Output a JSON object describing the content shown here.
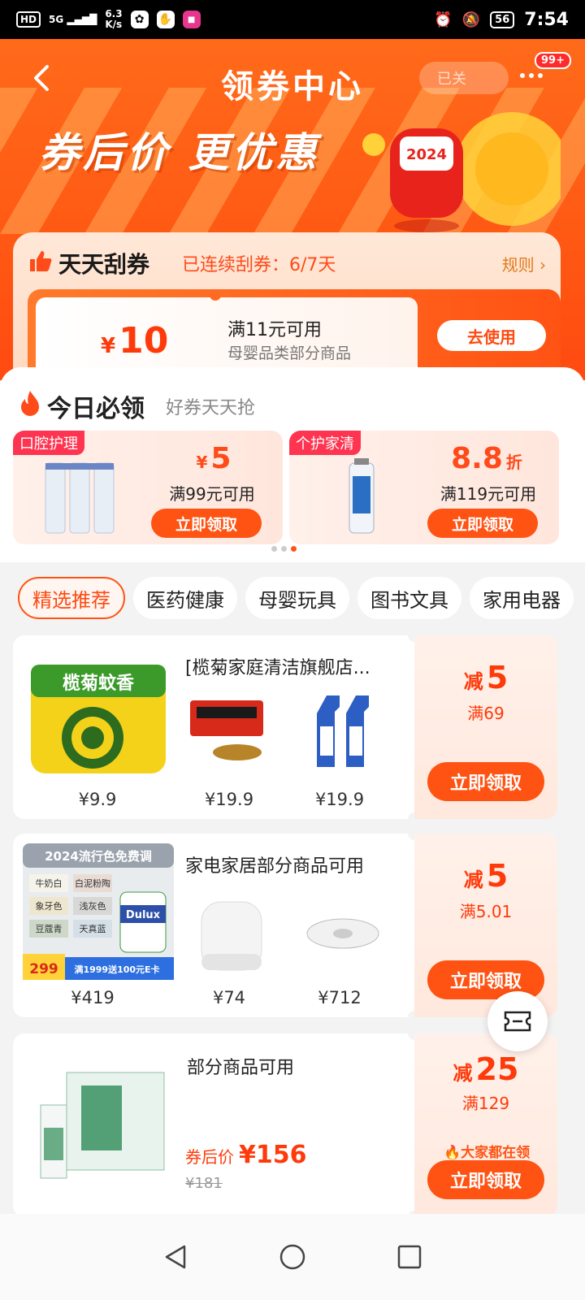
{
  "status_bar": {
    "hd": "HD",
    "network": "5G",
    "speed_value": "6.3",
    "speed_unit": "K/s",
    "battery": "56",
    "time": "7:54"
  },
  "header": {
    "title": "领券中心",
    "right_pill": "已关",
    "badge": "99+",
    "slogan": "券后价 更优惠",
    "mascot_text": "2024"
  },
  "scratch": {
    "title": "天天刮券",
    "streak": "已连续刮券：6/7天",
    "rules": "规则 ›",
    "coupon": {
      "currency": "¥",
      "amount": "10",
      "condition": "满11元可用",
      "scope": "母婴品类部分商品",
      "button": "去使用"
    }
  },
  "today": {
    "title": "今日必领",
    "subtitle": "好券天天抢",
    "coupons": [
      {
        "tag": "口腔护理",
        "currency": "¥",
        "value": "5",
        "unit": "",
        "condition": "满99元可用",
        "button": "立即领取"
      },
      {
        "tag": "个护家清",
        "currency": "",
        "value": "8.8",
        "unit": "折",
        "condition": "满119元可用",
        "button": "立即领取"
      }
    ]
  },
  "tabs": [
    "精选推荐",
    "医药健康",
    "母婴玩具",
    "图书文具",
    "家用电器"
  ],
  "cards": [
    {
      "shop": "[榄菊家庭清洁旗舰店...",
      "prices": [
        "¥9.9",
        "¥19.9",
        "¥19.9"
      ],
      "discount_prefix": "减",
      "discount": "5",
      "min": "满69",
      "button": "立即领取",
      "image_text": "榄菊蚊香"
    },
    {
      "shop": "家电家居部分商品可用",
      "prices": [
        "¥419",
        "¥74",
        "¥712"
      ],
      "discount_prefix": "减",
      "discount": "5",
      "min": "满5.01",
      "button": "立即领取",
      "image_text": "2024流行色免费调",
      "image_swatches": [
        "牛奶白",
        "白泥粉陶",
        "象牙色",
        "浅灰色",
        "豆蔻青",
        "天真蓝"
      ],
      "image_price": "299",
      "image_promo": "满1999送100元E卡",
      "image_brand": "Dulux"
    },
    {
      "shop": "部分商品可用",
      "after_label": "券后价",
      "after_price": "¥156",
      "orig_price": "¥181",
      "discount_prefix": "减",
      "discount": "25",
      "min": "满129",
      "hot": "大家都在领",
      "button": "立即领取"
    }
  ]
}
